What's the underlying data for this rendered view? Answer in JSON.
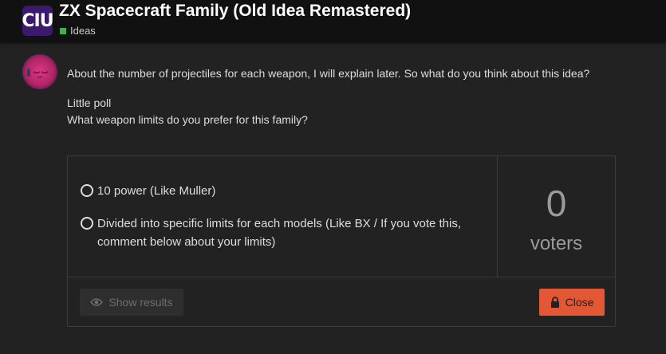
{
  "header": {
    "logo_text": "CIU",
    "title": "ZX Spacecraft Family (Old Idea Remastered)",
    "category": "Ideas",
    "category_color": "#3ab54a"
  },
  "post": {
    "paragraph1": "About the number of projectiles for each weapon, I will explain later. So what do you think about this idea?",
    "poll_heading": "Little poll",
    "poll_question": "What weapon limits do you prefer for this family?"
  },
  "poll": {
    "options": [
      {
        "label": "10 power (Like Muller)"
      },
      {
        "label": "Divided into specific limits for each models (Like BX / If you vote this, comment below about your limits)"
      }
    ],
    "voter_count": "0",
    "voter_label": "voters",
    "show_results_label": "Show results",
    "close_label": "Close",
    "close_color": "#e45735"
  },
  "icons": {
    "category": "category-square-icon",
    "eye": "eye-icon",
    "lock": "lock-icon"
  }
}
